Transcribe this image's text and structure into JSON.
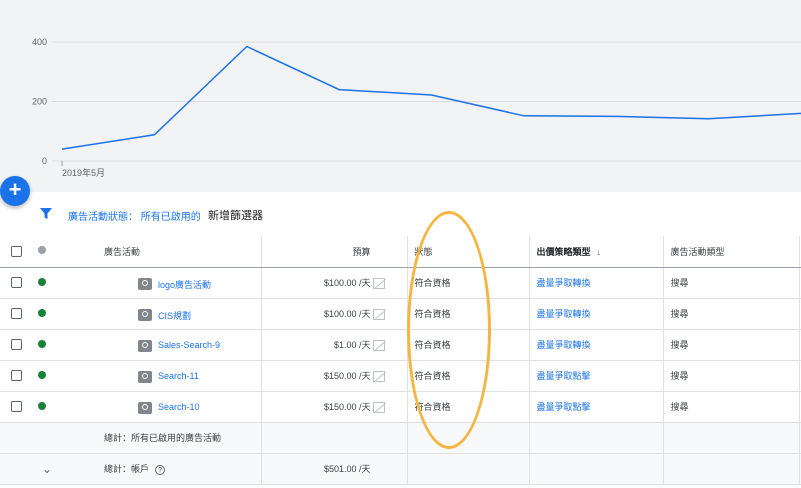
{
  "chart_data": {
    "type": "line",
    "color": "#1a73e8",
    "y_ticks": [
      "400",
      "200",
      "0"
    ],
    "ylim": [
      0,
      400
    ],
    "x_label": "2019年5月",
    "values": [
      40,
      88,
      385,
      240,
      222,
      152,
      150,
      142,
      160
    ]
  },
  "fab": {
    "label": "+"
  },
  "filter": {
    "icon": "filter-icon",
    "label": "廣告活動狀態：",
    "value": "所有已啟用的",
    "add_label": "新增篩選器"
  },
  "table": {
    "headers": {
      "campaign": "廣告活動",
      "budget": "預算",
      "status": "狀態",
      "bid_strategy": "出價策略類型",
      "campaign_type": "廣告活動類型"
    },
    "rows": [
      {
        "name": "logo廣告活動",
        "budget": "$100.00 /天",
        "status": "符合資格",
        "bid": "盡量爭取轉換",
        "type": "搜尋"
      },
      {
        "name": "CIS規劃",
        "budget": "$100.00 /天",
        "status": "符合資格",
        "bid": "盡量爭取轉換",
        "type": "搜尋"
      },
      {
        "name": "Sales-Search-9",
        "budget": "$1.00 /天",
        "status": "符合資格",
        "bid": "盡量爭取轉換",
        "type": "搜尋"
      },
      {
        "name": "Search-11",
        "budget": "$150.00 /天",
        "status": "符合資格",
        "bid": "盡量爭取點擊",
        "type": "搜尋"
      },
      {
        "name": "Search-10",
        "budget": "$150.00 /天",
        "status": "符合資格",
        "bid": "盡量爭取點擊",
        "type": "搜尋"
      }
    ],
    "total_enabled_label": "總計：所有已啟用的廣告活動",
    "total_account_label": "總計：帳戶",
    "total_account_budget": "$501.00 /天",
    "help_symbol": "?",
    "chevron": "⌄",
    "sort_arrow": "↓"
  },
  "colors": {
    "accent": "#1a73e8",
    "status_green": "#188038",
    "highlight": "#f6b540"
  }
}
